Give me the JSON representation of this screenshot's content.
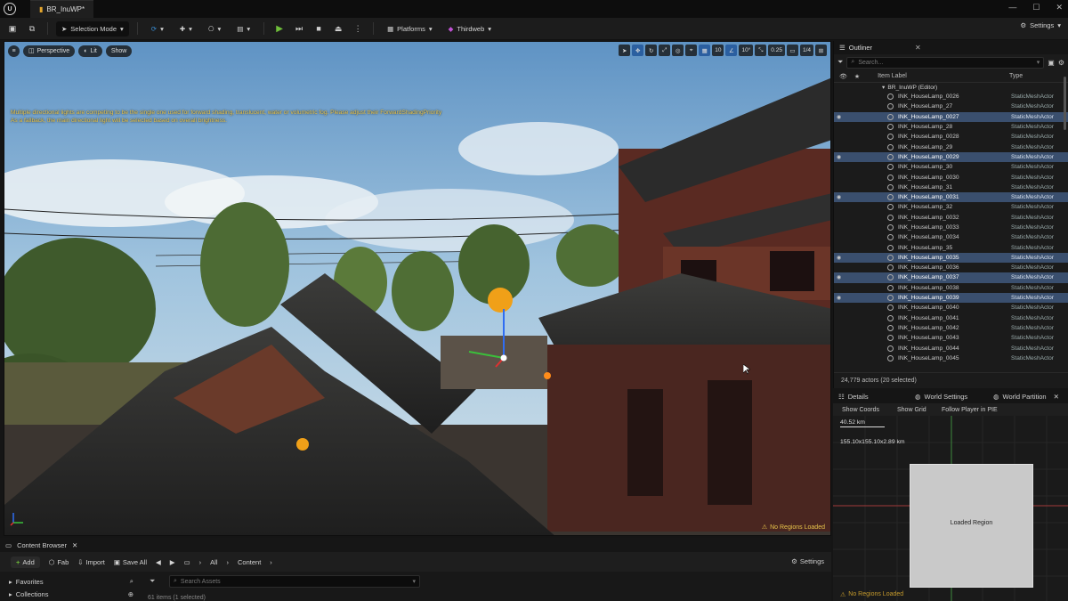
{
  "window": {
    "tab_title": "BR_InuWP*",
    "controls": [
      "—",
      "☐",
      "✕"
    ]
  },
  "toolbar": {
    "mode_label": "Selection Mode",
    "platforms_label": "Platforms",
    "thirdweb_label": "Thirdweb",
    "settings_label": "Settings"
  },
  "viewport": {
    "perspective_label": "Perspective",
    "lit_label": "Lit",
    "show_label": "Show",
    "grid_value": "10",
    "angle_value": "10°",
    "scale_value": "0.25",
    "camera_speed": "1/4",
    "warning_line1": "Multiple directional lights are competing to be the single one used for forward shading, translucent, water or volumetric fog. Please adjust their ForwardShadingPriority",
    "warning_line2": "As a fallback, the main directional light will be selected based on overall brightness.",
    "no_regions": "No Regions Loaded"
  },
  "outliner": {
    "tab_label": "Outliner",
    "search_placeholder": "Search...",
    "col_label": "Item Label",
    "col_type": "Type",
    "world_label": "BR_InuWP (Editor)",
    "rows": [
      {
        "name": "INK_HouseLamp_0026",
        "type": "StaticMeshActor",
        "sel": false
      },
      {
        "name": "INK_HouseLamp_27",
        "type": "StaticMeshActor",
        "sel": false
      },
      {
        "name": "INK_HouseLamp_0027",
        "type": "StaticMeshActor",
        "sel": true
      },
      {
        "name": "INK_HouseLamp_28",
        "type": "StaticMeshActor",
        "sel": false
      },
      {
        "name": "INK_HouseLamp_0028",
        "type": "StaticMeshActor",
        "sel": false
      },
      {
        "name": "INK_HouseLamp_29",
        "type": "StaticMeshActor",
        "sel": false
      },
      {
        "name": "INK_HouseLamp_0029",
        "type": "StaticMeshActor",
        "sel": true
      },
      {
        "name": "INK_HouseLamp_30",
        "type": "StaticMeshActor",
        "sel": false
      },
      {
        "name": "INK_HouseLamp_0030",
        "type": "StaticMeshActor",
        "sel": false
      },
      {
        "name": "INK_HouseLamp_31",
        "type": "StaticMeshActor",
        "sel": false
      },
      {
        "name": "INK_HouseLamp_0031",
        "type": "StaticMeshActor",
        "sel": true
      },
      {
        "name": "INK_HouseLamp_32",
        "type": "StaticMeshActor",
        "sel": false
      },
      {
        "name": "INK_HouseLamp_0032",
        "type": "StaticMeshActor",
        "sel": false
      },
      {
        "name": "INK_HouseLamp_0033",
        "type": "StaticMeshActor",
        "sel": false
      },
      {
        "name": "INK_HouseLamp_0034",
        "type": "StaticMeshActor",
        "sel": false
      },
      {
        "name": "INK_HouseLamp_35",
        "type": "StaticMeshActor",
        "sel": false
      },
      {
        "name": "INK_HouseLamp_0035",
        "type": "StaticMeshActor",
        "sel": true
      },
      {
        "name": "INK_HouseLamp_0036",
        "type": "StaticMeshActor",
        "sel": false
      },
      {
        "name": "INK_HouseLamp_0037",
        "type": "StaticMeshActor",
        "sel": true
      },
      {
        "name": "INK_HouseLamp_0038",
        "type": "StaticMeshActor",
        "sel": false
      },
      {
        "name": "INK_HouseLamp_0039",
        "type": "StaticMeshActor",
        "sel": true
      },
      {
        "name": "INK_HouseLamp_0040",
        "type": "StaticMeshActor",
        "sel": false
      },
      {
        "name": "INK_HouseLamp_0041",
        "type": "StaticMeshActor",
        "sel": false
      },
      {
        "name": "INK_HouseLamp_0042",
        "type": "StaticMeshActor",
        "sel": false
      },
      {
        "name": "INK_HouseLamp_0043",
        "type": "StaticMeshActor",
        "sel": false
      },
      {
        "name": "INK_HouseLamp_0044",
        "type": "StaticMeshActor",
        "sel": false
      },
      {
        "name": "INK_HouseLamp_0045",
        "type": "StaticMeshActor",
        "sel": false
      }
    ],
    "footer": "24,779 actors (20 selected)"
  },
  "details_tabs": {
    "details": "Details",
    "world_settings": "World Settings",
    "world_partition": "World Partition"
  },
  "world_partition": {
    "coords_label": "Show Coords",
    "show_grid": "Show Grid",
    "follow_player": "Follow Player in PIE",
    "distance": "40.52 km",
    "dims": "155.10x155.10x2.89 km",
    "loaded_region": "Loaded Region",
    "no_regions": "No Regions Loaded"
  },
  "content_browser": {
    "tab_label": "Content Browser",
    "add_label": "Add",
    "fab_label": "Fab",
    "import_label": "Import",
    "save_all_label": "Save All",
    "path_all": "All",
    "path_content": "Content",
    "settings_label": "Settings",
    "favorites_label": "Favorites",
    "collections_label": "Collections",
    "search_placeholder": "Search Assets",
    "count_text": "61 items (1 selected)"
  },
  "colors": {
    "accent_blue": "#2b5fa0",
    "selection": "#3a4f6e",
    "warning": "#e6c24a",
    "play_green": "#6fbf3a"
  }
}
